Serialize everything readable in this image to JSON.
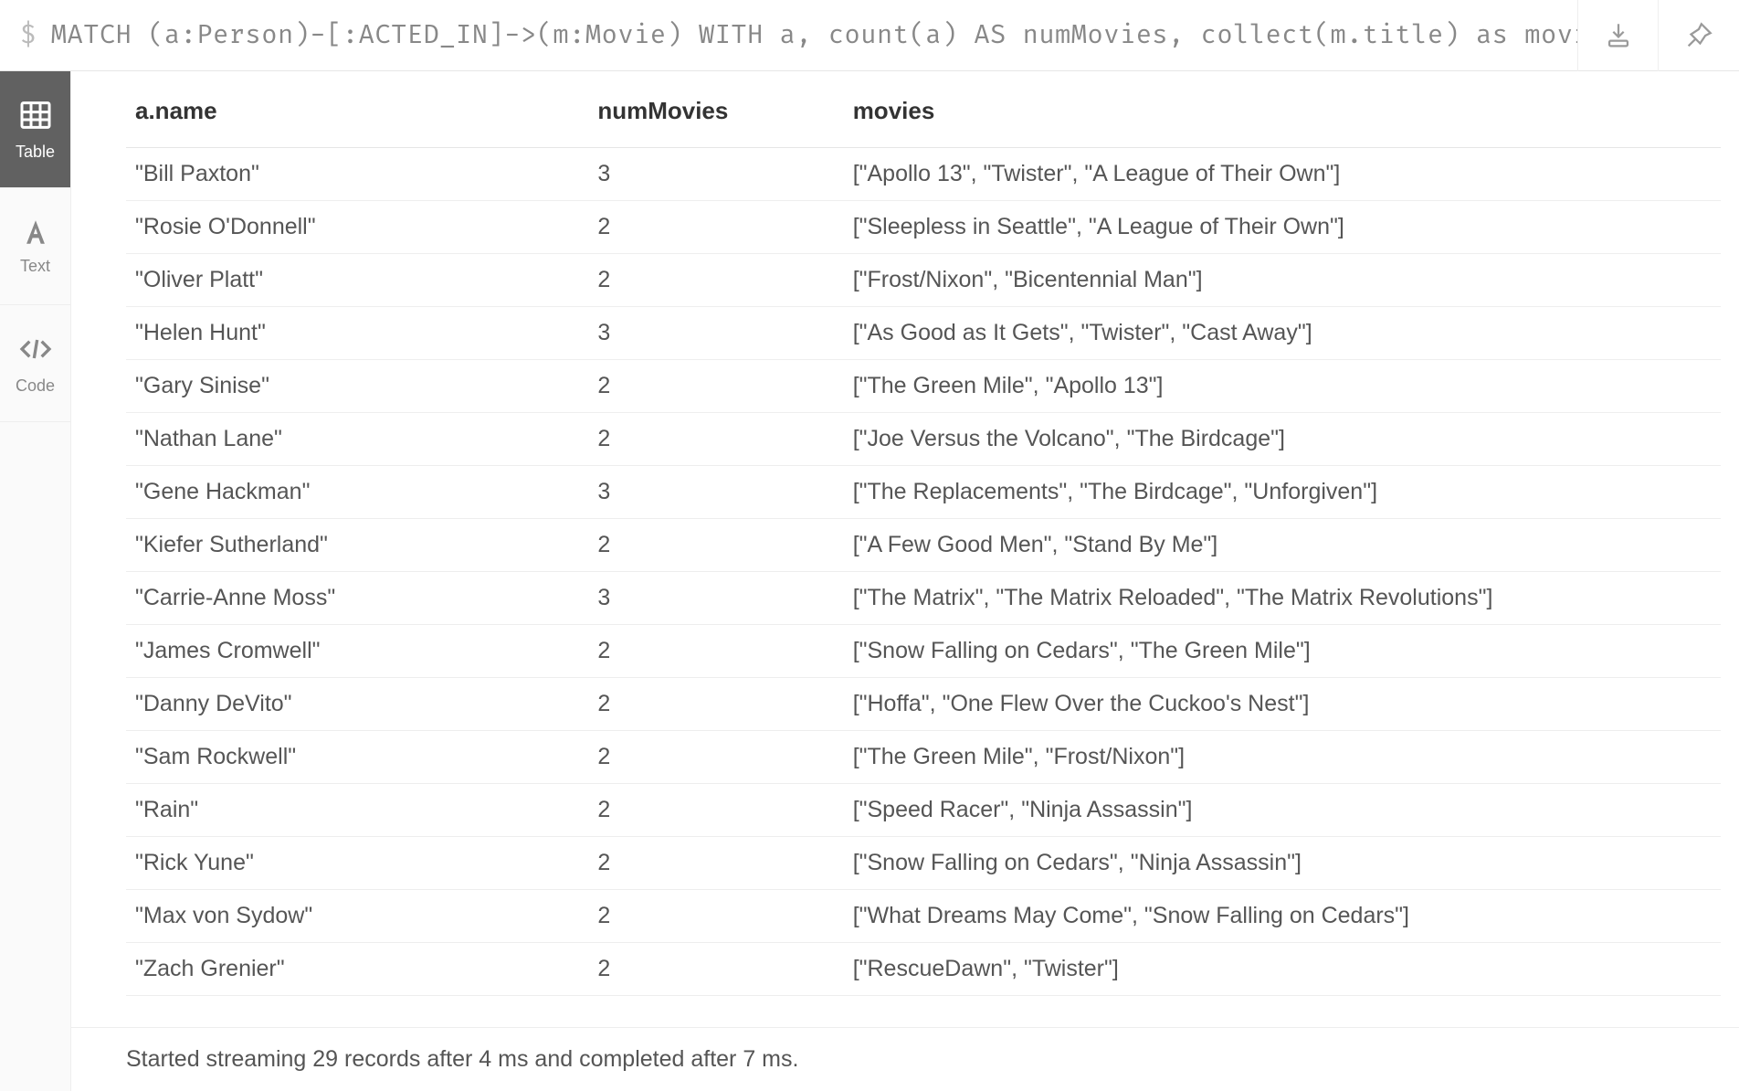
{
  "query": {
    "prompt": "$",
    "text": "MATCH (a:Person)-[:ACTED_IN]->(m:Movie) WITH a, count(a) AS numMovies, collect(m.title) as movies…"
  },
  "sidebar": {
    "tabs": [
      {
        "label": "Table",
        "active": true
      },
      {
        "label": "Text",
        "active": false
      },
      {
        "label": "Code",
        "active": false
      }
    ]
  },
  "columns": {
    "c0": "a.name",
    "c1": "numMovies",
    "c2": "movies"
  },
  "rows": [
    {
      "name": "\"Bill Paxton\"",
      "num": "3",
      "movies": "[\"Apollo 13\", \"Twister\", \"A League of Their Own\"]"
    },
    {
      "name": "\"Rosie O'Donnell\"",
      "num": "2",
      "movies": "[\"Sleepless in Seattle\", \"A League of Their Own\"]"
    },
    {
      "name": "\"Oliver Platt\"",
      "num": "2",
      "movies": "[\"Frost/Nixon\", \"Bicentennial Man\"]"
    },
    {
      "name": "\"Helen Hunt\"",
      "num": "3",
      "movies": "[\"As Good as It Gets\", \"Twister\", \"Cast Away\"]"
    },
    {
      "name": "\"Gary Sinise\"",
      "num": "2",
      "movies": "[\"The Green Mile\", \"Apollo 13\"]"
    },
    {
      "name": "\"Nathan Lane\"",
      "num": "2",
      "movies": "[\"Joe Versus the Volcano\", \"The Birdcage\"]"
    },
    {
      "name": "\"Gene Hackman\"",
      "num": "3",
      "movies": "[\"The Replacements\", \"The Birdcage\", \"Unforgiven\"]"
    },
    {
      "name": "\"Kiefer Sutherland\"",
      "num": "2",
      "movies": "[\"A Few Good Men\", \"Stand By Me\"]"
    },
    {
      "name": "\"Carrie-Anne Moss\"",
      "num": "3",
      "movies": "[\"The Matrix\", \"The Matrix Reloaded\", \"The Matrix Revolutions\"]"
    },
    {
      "name": "\"James Cromwell\"",
      "num": "2",
      "movies": "[\"Snow Falling on Cedars\", \"The Green Mile\"]"
    },
    {
      "name": "\"Danny DeVito\"",
      "num": "2",
      "movies": "[\"Hoffa\", \"One Flew Over the Cuckoo's Nest\"]"
    },
    {
      "name": "\"Sam Rockwell\"",
      "num": "2",
      "movies": "[\"The Green Mile\", \"Frost/Nixon\"]"
    },
    {
      "name": "\"Rain\"",
      "num": "2",
      "movies": "[\"Speed Racer\", \"Ninja Assassin\"]"
    },
    {
      "name": "\"Rick Yune\"",
      "num": "2",
      "movies": "[\"Snow Falling on Cedars\", \"Ninja Assassin\"]"
    },
    {
      "name": "\"Max von Sydow\"",
      "num": "2",
      "movies": "[\"What Dreams May Come\", \"Snow Falling on Cedars\"]"
    },
    {
      "name": "\"Zach Grenier\"",
      "num": "2",
      "movies": "[\"RescueDawn\", \"Twister\"]"
    }
  ],
  "footer": {
    "status": "Started streaming 29 records after 4 ms and completed after 7 ms."
  }
}
